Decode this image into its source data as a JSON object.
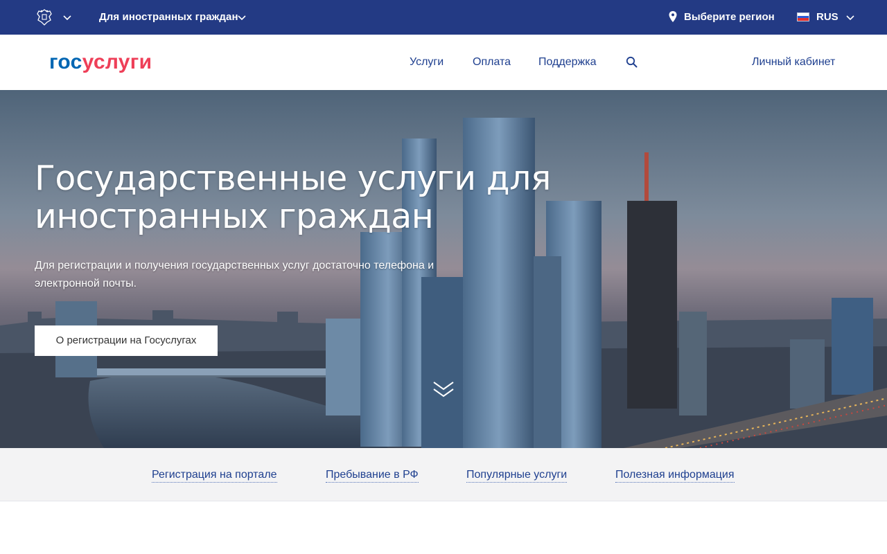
{
  "topbar": {
    "audience_label": "Для иностранных граждан",
    "region_label": "Выберите регион",
    "language_label": "RUS",
    "background_color": "#233a84"
  },
  "header": {
    "logo_part1": "гос",
    "logo_part2": "услуги",
    "nav": [
      {
        "label": "Услуги"
      },
      {
        "label": "Оплата"
      },
      {
        "label": "Поддержка"
      }
    ],
    "search_icon": "search-icon",
    "cabinet_label": "Личный кабинет"
  },
  "hero": {
    "title": "Государственные услуги для иностранных граждан",
    "subtitle": "Для регистрации и получения государственных услуг достаточно телефона и электронной почты.",
    "button_label": "О регистрации на Госуслугах"
  },
  "subnav": {
    "links": [
      {
        "label": "Регистрация на портале"
      },
      {
        "label": "Пребывание в РФ"
      },
      {
        "label": "Популярные услуги"
      },
      {
        "label": "Полезная информация"
      }
    ]
  },
  "colors": {
    "accent_blue": "#0066b3",
    "accent_red": "#ee3f58",
    "link": "#1e3f8f"
  }
}
